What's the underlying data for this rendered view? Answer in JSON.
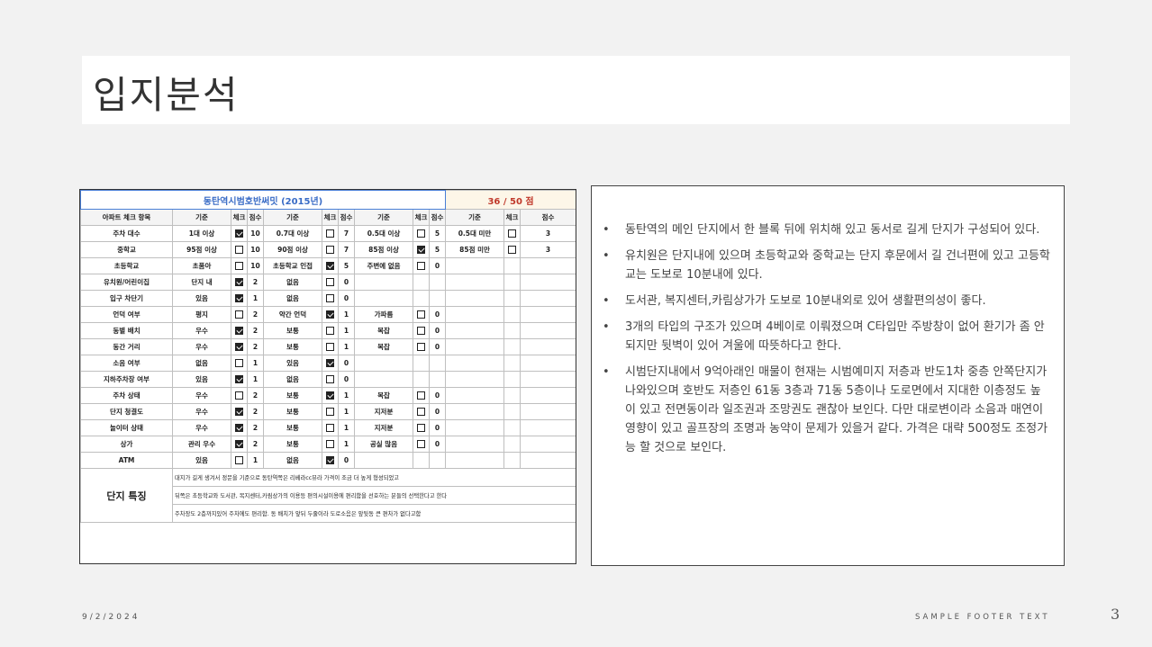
{
  "slide": {
    "title": "입지분석",
    "date": "9/2/2024",
    "footer": "SAMPLE FOOTER TEXT",
    "page_number": "3"
  },
  "table": {
    "title": "동탄역시범호반써밋 (2015년)",
    "score": "36 / 50 점",
    "headers": [
      "아파트 체크 항목",
      "기준",
      "체크",
      "점수",
      "기준",
      "체크",
      "점수",
      "기준",
      "체크",
      "점수",
      "기준",
      "체크",
      "점수"
    ],
    "rows": [
      {
        "item": "주차 대수",
        "c": [
          [
            "1대 이상",
            true,
            "10"
          ],
          [
            "0.7대 이상",
            false,
            "7"
          ],
          [
            "0.5대 이상",
            false,
            "5"
          ],
          [
            "0.5대 미만",
            false,
            "3"
          ]
        ]
      },
      {
        "item": "중학교",
        "c": [
          [
            "95점 이상",
            false,
            "10"
          ],
          [
            "90점 이상",
            false,
            "7"
          ],
          [
            "85점 이상",
            true,
            "5"
          ],
          [
            "85점 미만",
            false,
            "3"
          ]
        ]
      },
      {
        "item": "초등학교",
        "c": [
          [
            "초품아",
            false,
            "10"
          ],
          [
            "초등학교 인접",
            true,
            "5"
          ],
          [
            "주변에 없음",
            false,
            "0"
          ],
          null
        ]
      },
      {
        "item": "유치원/어린이집",
        "c": [
          [
            "단지 내",
            true,
            "2"
          ],
          [
            "없음",
            false,
            "0"
          ],
          null,
          null
        ]
      },
      {
        "item": "입구 차단기",
        "c": [
          [
            "있음",
            true,
            "1"
          ],
          [
            "없음",
            false,
            "0"
          ],
          null,
          null
        ]
      },
      {
        "item": "언덕 여부",
        "c": [
          [
            "평지",
            false,
            "2"
          ],
          [
            "약간 언덕",
            true,
            "1"
          ],
          [
            "가파름",
            false,
            "0"
          ],
          null
        ]
      },
      {
        "item": "동별 배치",
        "c": [
          [
            "우수",
            true,
            "2"
          ],
          [
            "보통",
            false,
            "1"
          ],
          [
            "복잡",
            false,
            "0"
          ],
          null
        ]
      },
      {
        "item": "동간 거리",
        "c": [
          [
            "우수",
            true,
            "2"
          ],
          [
            "보통",
            false,
            "1"
          ],
          [
            "복잡",
            false,
            "0"
          ],
          null
        ]
      },
      {
        "item": "소음 여부",
        "c": [
          [
            "없음",
            false,
            "1"
          ],
          [
            "있음",
            true,
            "0"
          ],
          null,
          null
        ]
      },
      {
        "item": "지하주차장 여부",
        "c": [
          [
            "있음",
            true,
            "1"
          ],
          [
            "없음",
            false,
            "0"
          ],
          null,
          null
        ]
      },
      {
        "item": "주차 상태",
        "c": [
          [
            "우수",
            false,
            "2"
          ],
          [
            "보통",
            true,
            "1"
          ],
          [
            "복잡",
            false,
            "0"
          ],
          null
        ]
      },
      {
        "item": "단지 청결도",
        "c": [
          [
            "우수",
            true,
            "2"
          ],
          [
            "보통",
            false,
            "1"
          ],
          [
            "지저분",
            false,
            "0"
          ],
          null
        ]
      },
      {
        "item": "놀이터 상태",
        "c": [
          [
            "우수",
            true,
            "2"
          ],
          [
            "보통",
            false,
            "1"
          ],
          [
            "지저분",
            false,
            "0"
          ],
          null
        ]
      },
      {
        "item": "상가",
        "c": [
          [
            "관리 우수",
            true,
            "2"
          ],
          [
            "보통",
            false,
            "1"
          ],
          [
            "공실 많음",
            false,
            "0"
          ],
          null
        ]
      },
      {
        "item": "ATM",
        "c": [
          [
            "있음",
            false,
            "1"
          ],
          [
            "없음",
            true,
            "0"
          ],
          null,
          null
        ]
      }
    ],
    "features_label": "단지 특징",
    "features": [
      "대지가 길게 생겨서 정문을 기준으로 동탄역쪽은 리베라cc뷰라 가격이 조금 더 높게 형성되었고",
      "뒤쪽은 초등학교와 도서관, 복지센터,카림상가의 이용등 편의시설이용에 편리함을 선호하는 분들의 선택한다고 한다",
      "주차장도 2층까지있어 주차에도 편리함. 동 배치가 앞뒤 두줄이라 도로소음은 앞뒷동 큰 편차가 없다고함"
    ]
  },
  "bullets": [
    "동탄역의 메인 단지에서 한 블록 뒤에 위치해 있고 동서로 길게 단지가 구성되어 있다.",
    "유치원은 단지내에 있으며 초등학교와 중학교는 단지 후문에서 길 건너편에 있고 고등학교는 도보로 10분내에 있다.",
    "도서관, 복지센터,카림상가가 도보로 10분내외로 있어 생활편의성이 좋다.",
    "3개의 타입의 구조가 있으며 4베이로 이뤄졌으며 C타입만 주방창이 없어 환기가 좀 안되지만 뒷벽이 있어 겨울에 따뜻하다고 한다.",
    "시범단지내에서 9억아래인 매물이 현재는 시범예미지 저층과 반도1차 중층 안쪽단지가 나와있으며 호반도 저층인 61동 3층과 71동 5층이나 도로면에서 지대한 이층정도 높이 있고 전면동이라 일조권과 조망권도 괜찮아 보인다. 다만 대로변이라 소음과 매연이 영향이 있고 골프장의 조명과 농약이 문제가 있을거 같다. 가격은 대략 500정도 조정가능 할 것으로 보인다."
  ]
}
